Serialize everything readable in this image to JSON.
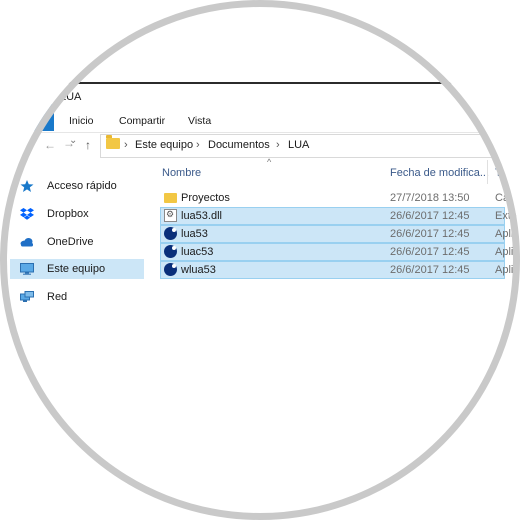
{
  "window": {
    "title": "LUA"
  },
  "ribbon": {
    "tabs": [
      "Inicio",
      "Compartir",
      "Vista"
    ]
  },
  "nav": {
    "back": "←",
    "forward": "→",
    "recent": "⌄",
    "up": "↑",
    "breadcrumb": [
      "Este equipo",
      "Documentos",
      "LUA"
    ],
    "separator": "›"
  },
  "sidebar": {
    "items": [
      {
        "label": "Acceso rápido",
        "icon": "star-icon",
        "selected": false
      },
      {
        "label": "Dropbox",
        "icon": "dropbox-icon",
        "selected": false
      },
      {
        "label": "OneDrive",
        "icon": "cloud-icon",
        "selected": false
      },
      {
        "label": "Este equipo",
        "icon": "computer-icon",
        "selected": true
      },
      {
        "label": "Red",
        "icon": "network-icon",
        "selected": false
      }
    ]
  },
  "columns": {
    "name": "Nombre",
    "date": "Fecha de modifica...",
    "type": "T"
  },
  "files": [
    {
      "name": "Proyectos",
      "date": "27/7/2018 13:50",
      "type": "Ca",
      "icon": "folder-icon",
      "selected": false
    },
    {
      "name": "lua53.dll",
      "date": "26/6/2017 12:45",
      "type": "Exte",
      "icon": "dll-file-icon",
      "selected": true
    },
    {
      "name": "lua53",
      "date": "26/6/2017 12:45",
      "type": "Apli",
      "icon": "lua-app-icon",
      "selected": true
    },
    {
      "name": "luac53",
      "date": "26/6/2017 12:45",
      "type": "Apli",
      "icon": "lua-app-icon",
      "selected": true
    },
    {
      "name": "wlua53",
      "date": "26/6/2017 12:45",
      "type": "Apli",
      "icon": "lua-app-icon",
      "selected": true
    }
  ],
  "colors": {
    "accent": "#1979ca",
    "selection": "#cce6f7",
    "folder": "#f2c744"
  }
}
